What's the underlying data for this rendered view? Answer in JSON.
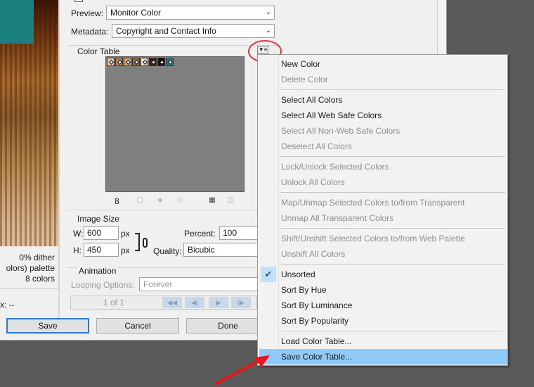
{
  "preview": {
    "dither": "0% dither",
    "palette": "olors) palette",
    "colors": "8 colors",
    "status": "x: --"
  },
  "settings": {
    "preview_label": "Preview:",
    "preview_value": "Monitor Color",
    "metadata_label": "Metadata:",
    "metadata_value": "Copyright and Contact Info",
    "color_table_label": "Color Table",
    "swatch_colors": [
      "#f0c8a0",
      "#c08040",
      "#e0a860",
      "#a06830",
      "#f0e0c0",
      "#3a1a10",
      "#1a0a08",
      "#1a8080"
    ],
    "color_count": "8"
  },
  "image_size": {
    "label": "Image Size",
    "w_label": "W:",
    "w_value": "600",
    "h_label": "H:",
    "h_value": "450",
    "unit": "px",
    "percent_label": "Percent:",
    "percent_value": "100",
    "quality_label": "Quality:",
    "quality_value": "Bicubic"
  },
  "animation": {
    "label": "Animation",
    "looping_label": "Looping Options:",
    "looping_value": "Forever",
    "frame_counter": "1 of 1"
  },
  "buttons": {
    "save": "Save",
    "cancel": "Cancel",
    "done": "Done"
  },
  "menu": {
    "items": [
      {
        "label": "New Color",
        "enabled": true
      },
      {
        "label": "Delete Color",
        "enabled": false
      },
      {
        "label": "Select All Colors",
        "enabled": true
      },
      {
        "label": "Select All Web Safe Colors",
        "enabled": true
      },
      {
        "label": "Select All Non-Web Safe Colors",
        "enabled": false
      },
      {
        "label": "Deselect All Colors",
        "enabled": false
      },
      {
        "label": "Lock/Unlock Selected Colors",
        "enabled": false
      },
      {
        "label": "Unlock All Colors",
        "enabled": false
      },
      {
        "label": "Map/Unmap Selected Colors to/from Transparent",
        "enabled": false
      },
      {
        "label": "Unmap All Transparent Colors",
        "enabled": false
      },
      {
        "label": "Shift/Unshift Selected Colors to/from Web Palette",
        "enabled": false
      },
      {
        "label": "Unshift All Colors",
        "enabled": false
      },
      {
        "label": "Unsorted",
        "enabled": true,
        "checked": true
      },
      {
        "label": "Sort By Hue",
        "enabled": true
      },
      {
        "label": "Sort By Luminance",
        "enabled": true
      },
      {
        "label": "Sort By Popularity",
        "enabled": true
      },
      {
        "label": "Load Color Table...",
        "enabled": true
      },
      {
        "label": "Save Color Table...",
        "enabled": true,
        "highlighted": true
      }
    ]
  },
  "annotations": {
    "circle_color": "#e8383a",
    "arrow_color": "#e8141a"
  }
}
